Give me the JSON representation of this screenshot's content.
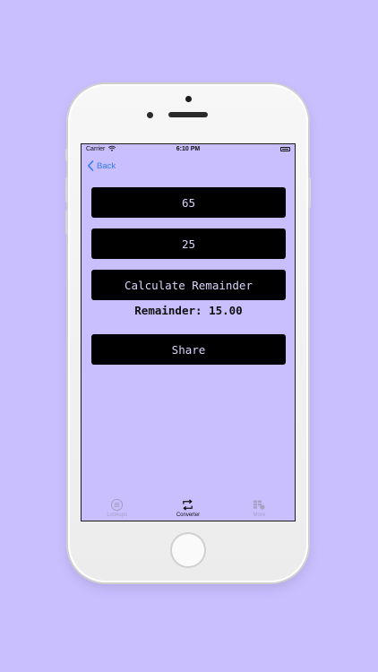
{
  "status_bar": {
    "carrier": "Carrier",
    "time": "6:10 PM"
  },
  "nav": {
    "back_label": "Back"
  },
  "form": {
    "dividend_value": "65",
    "divisor_value": "25",
    "calculate_label": "Calculate Remainder",
    "result_text": "Remainder: 15.00",
    "share_label": "Share"
  },
  "tab_bar": {
    "tabs": [
      {
        "label": "Lookups",
        "icon": "list-icon",
        "active": false
      },
      {
        "label": "Converter",
        "icon": "swap-arrows-icon",
        "active": true
      },
      {
        "label": "More",
        "icon": "more-grid-icon",
        "active": false
      }
    ]
  },
  "colors": {
    "background": "#c9bfff",
    "field_background": "#000000",
    "field_text": "#d9d6ff",
    "link_blue": "#2f7bf5",
    "tab_inactive": "#a7a2c4"
  }
}
